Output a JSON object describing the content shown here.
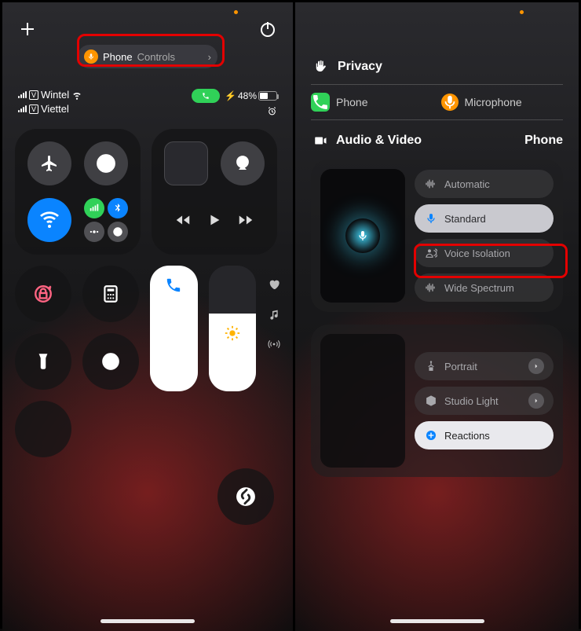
{
  "left": {
    "pill": {
      "app": "Phone",
      "sub": "Controls"
    },
    "carriers": [
      "Wintel",
      "Viettel"
    ],
    "battery": "48%",
    "battery_prefix": "⚡"
  },
  "right": {
    "privacy_label": "Privacy",
    "phone_label": "Phone",
    "mic_label": "Microphone",
    "av_label": "Audio & Video",
    "av_app": "Phone",
    "mic_modes": {
      "auto": "Automatic",
      "standard": "Standard",
      "isolation": "Voice Isolation",
      "wide": "Wide Spectrum"
    },
    "video_modes": {
      "portrait": "Portrait",
      "studio": "Studio Light",
      "reactions": "Reactions"
    }
  }
}
